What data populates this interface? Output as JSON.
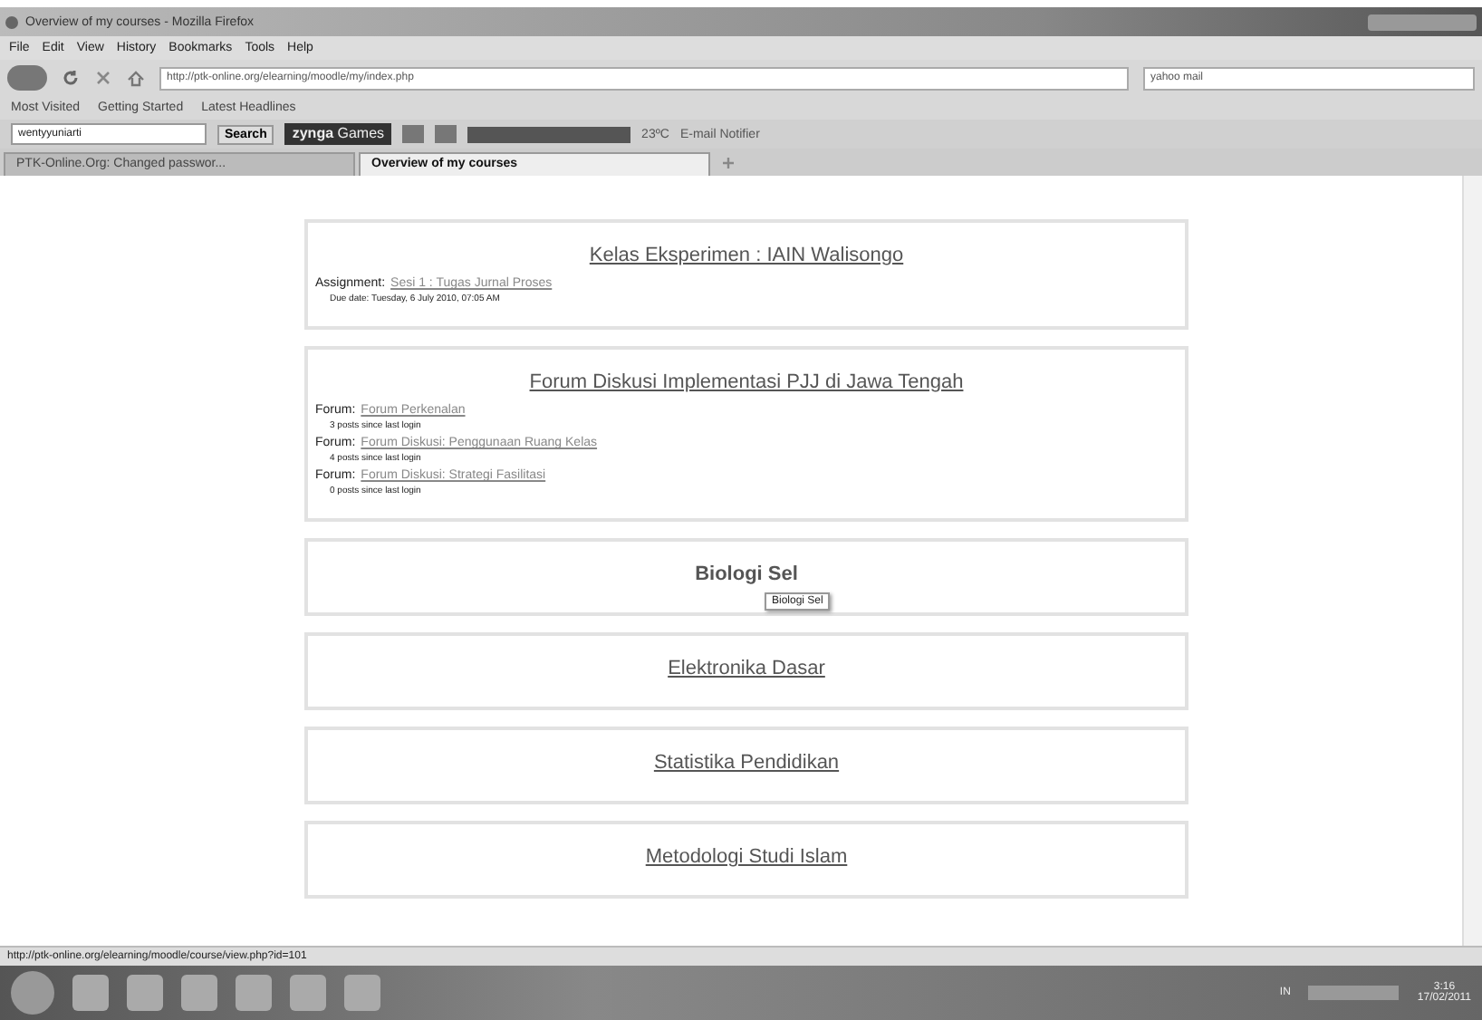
{
  "window": {
    "title": "Overview of my courses - Mozilla Firefox"
  },
  "menu": [
    "File",
    "Edit",
    "View",
    "History",
    "Bookmarks",
    "Tools",
    "Help"
  ],
  "address": {
    "value": "http://ptk-online.org/elearning/moodle/my/index.php"
  },
  "search_engine": {
    "value": "yahoo mail"
  },
  "bookmarks": [
    "Most Visited",
    "Getting Started",
    "Latest Headlines"
  ],
  "toolbar": {
    "user": "wentyyuniarti",
    "search_button": "Search",
    "zynga": "zynga",
    "games": "Games",
    "weather": "23ºC",
    "email": "E-mail Notifier"
  },
  "tabs": [
    {
      "label": "PTK-Online.Org: Changed passwor...",
      "selected": false
    },
    {
      "label": "Overview of my courses",
      "selected": true
    }
  ],
  "courses": [
    {
      "title": "Kelas Eksperimen : IAIN Walisongo",
      "entries": [
        {
          "type": "Assignment:",
          "link": "Sesi 1 : Tugas Jurnal Proses",
          "note": "Due date: Tuesday, 6 July 2010, 07:05 AM"
        }
      ]
    },
    {
      "title": "Forum Diskusi Implementasi PJJ di Jawa Tengah",
      "entries": [
        {
          "type": "Forum:",
          "link": "Forum Perkenalan",
          "note": "3 posts since last login"
        },
        {
          "type": "Forum:",
          "link": "Forum Diskusi: Penggunaan Ruang Kelas",
          "note": "4 posts since last login"
        },
        {
          "type": "Forum:",
          "link": "Forum Diskusi: Strategi Fasilitasi",
          "note": "0 posts since last login"
        }
      ]
    },
    {
      "title": "Biologi Sel",
      "hovered": true
    },
    {
      "title": "Elektronika Dasar",
      "hovered": false
    },
    {
      "title": "Statistika Pendidikan",
      "hovered": false
    },
    {
      "title": "Metodologi Studi Islam",
      "hovered": false
    }
  ],
  "tooltip": "Biologi Sel",
  "status_bar": "http://ptk-online.org/elearning/moodle/course/view.php?id=101",
  "taskbar": {
    "language": "IN",
    "time": "3:16",
    "date": "17/02/2011"
  }
}
